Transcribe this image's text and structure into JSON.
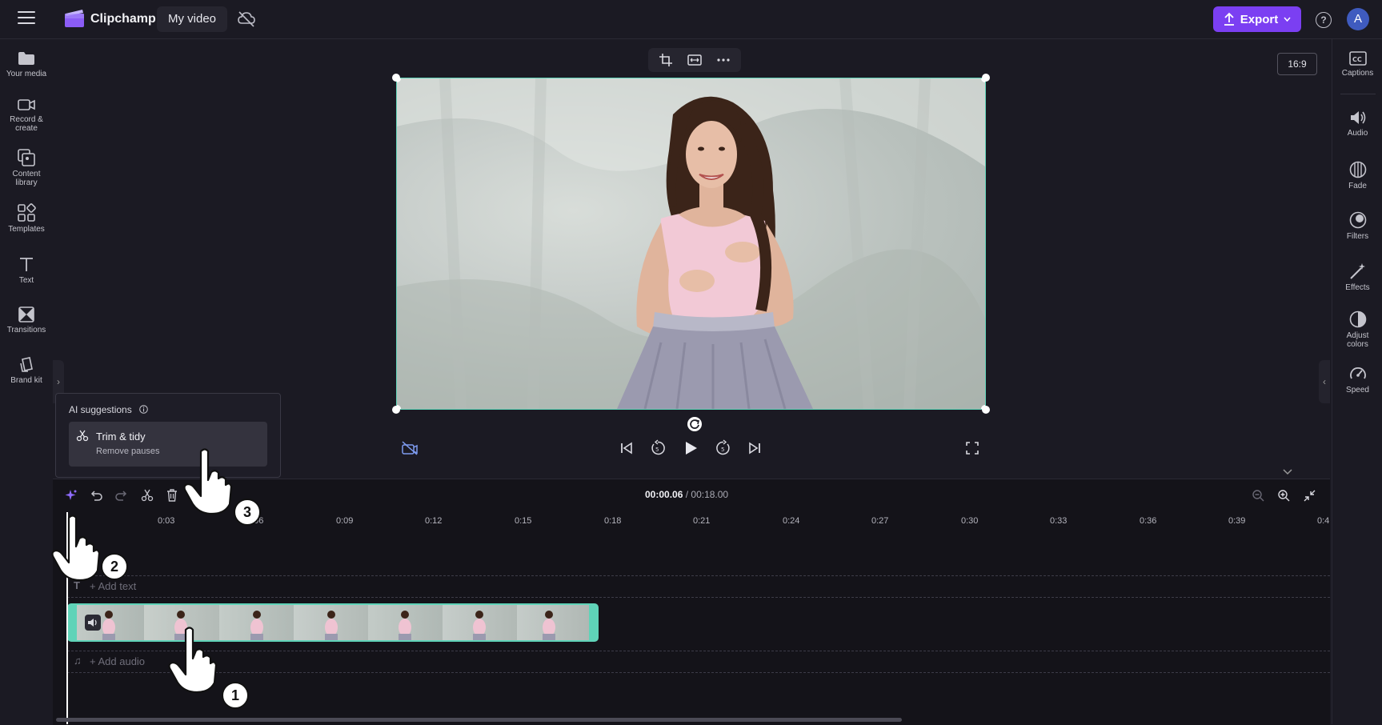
{
  "header": {
    "app_name": "Clipchamp",
    "project_title": "My video",
    "export_label": "Export",
    "help_glyph": "?",
    "avatar_initial": "A",
    "accent_color": "#7b3ff2"
  },
  "left_rail": {
    "items": [
      {
        "label_1": "Your media",
        "label_2": "",
        "icon": "folder-icon"
      },
      {
        "label_1": "Record &",
        "label_2": "create",
        "icon": "camera-icon"
      },
      {
        "label_1": "Content",
        "label_2": "library",
        "icon": "library-icon"
      },
      {
        "label_1": "Templates",
        "label_2": "",
        "icon": "templates-icon"
      },
      {
        "label_1": "Text",
        "label_2": "",
        "icon": "text-icon"
      },
      {
        "label_1": "Transitions",
        "label_2": "",
        "icon": "transitions-icon"
      },
      {
        "label_1": "Brand kit",
        "label_2": "",
        "icon": "brand-kit-icon"
      }
    ]
  },
  "right_rail": {
    "items": [
      {
        "label_1": "Captions",
        "label_2": "",
        "icon": "captions-icon"
      },
      {
        "label_1": "Audio",
        "label_2": "",
        "icon": "audio-icon"
      },
      {
        "label_1": "Fade",
        "label_2": "",
        "icon": "fade-icon"
      },
      {
        "label_1": "Filters",
        "label_2": "",
        "icon": "filters-icon"
      },
      {
        "label_1": "Effects",
        "label_2": "",
        "icon": "effects-icon"
      },
      {
        "label_1": "Adjust",
        "label_2": "colors",
        "icon": "adjust-colors-icon"
      },
      {
        "label_1": "Speed",
        "label_2": "",
        "icon": "speed-icon"
      }
    ]
  },
  "preview": {
    "aspect_ratio": "16:9",
    "selection_color": "#5fd3b8"
  },
  "ai_suggestions": {
    "title": "AI suggestions",
    "card_title": "Trim & tidy",
    "card_subtitle": "Remove pauses"
  },
  "timeline": {
    "current_time": "00:00.06",
    "separator": " / ",
    "total_time": "00:18.00",
    "ruler_labels": [
      "0:03",
      "0:06",
      "0:09",
      "0:12",
      "0:15",
      "0:18",
      "0:21",
      "0:24",
      "0:27",
      "0:30",
      "0:33",
      "0:36",
      "0:39",
      "0:4"
    ],
    "add_text_label": "+ Add text",
    "add_audio_label": "+ Add audio"
  },
  "annotations": {
    "step_1": "1",
    "step_2": "2",
    "step_3": "3"
  }
}
